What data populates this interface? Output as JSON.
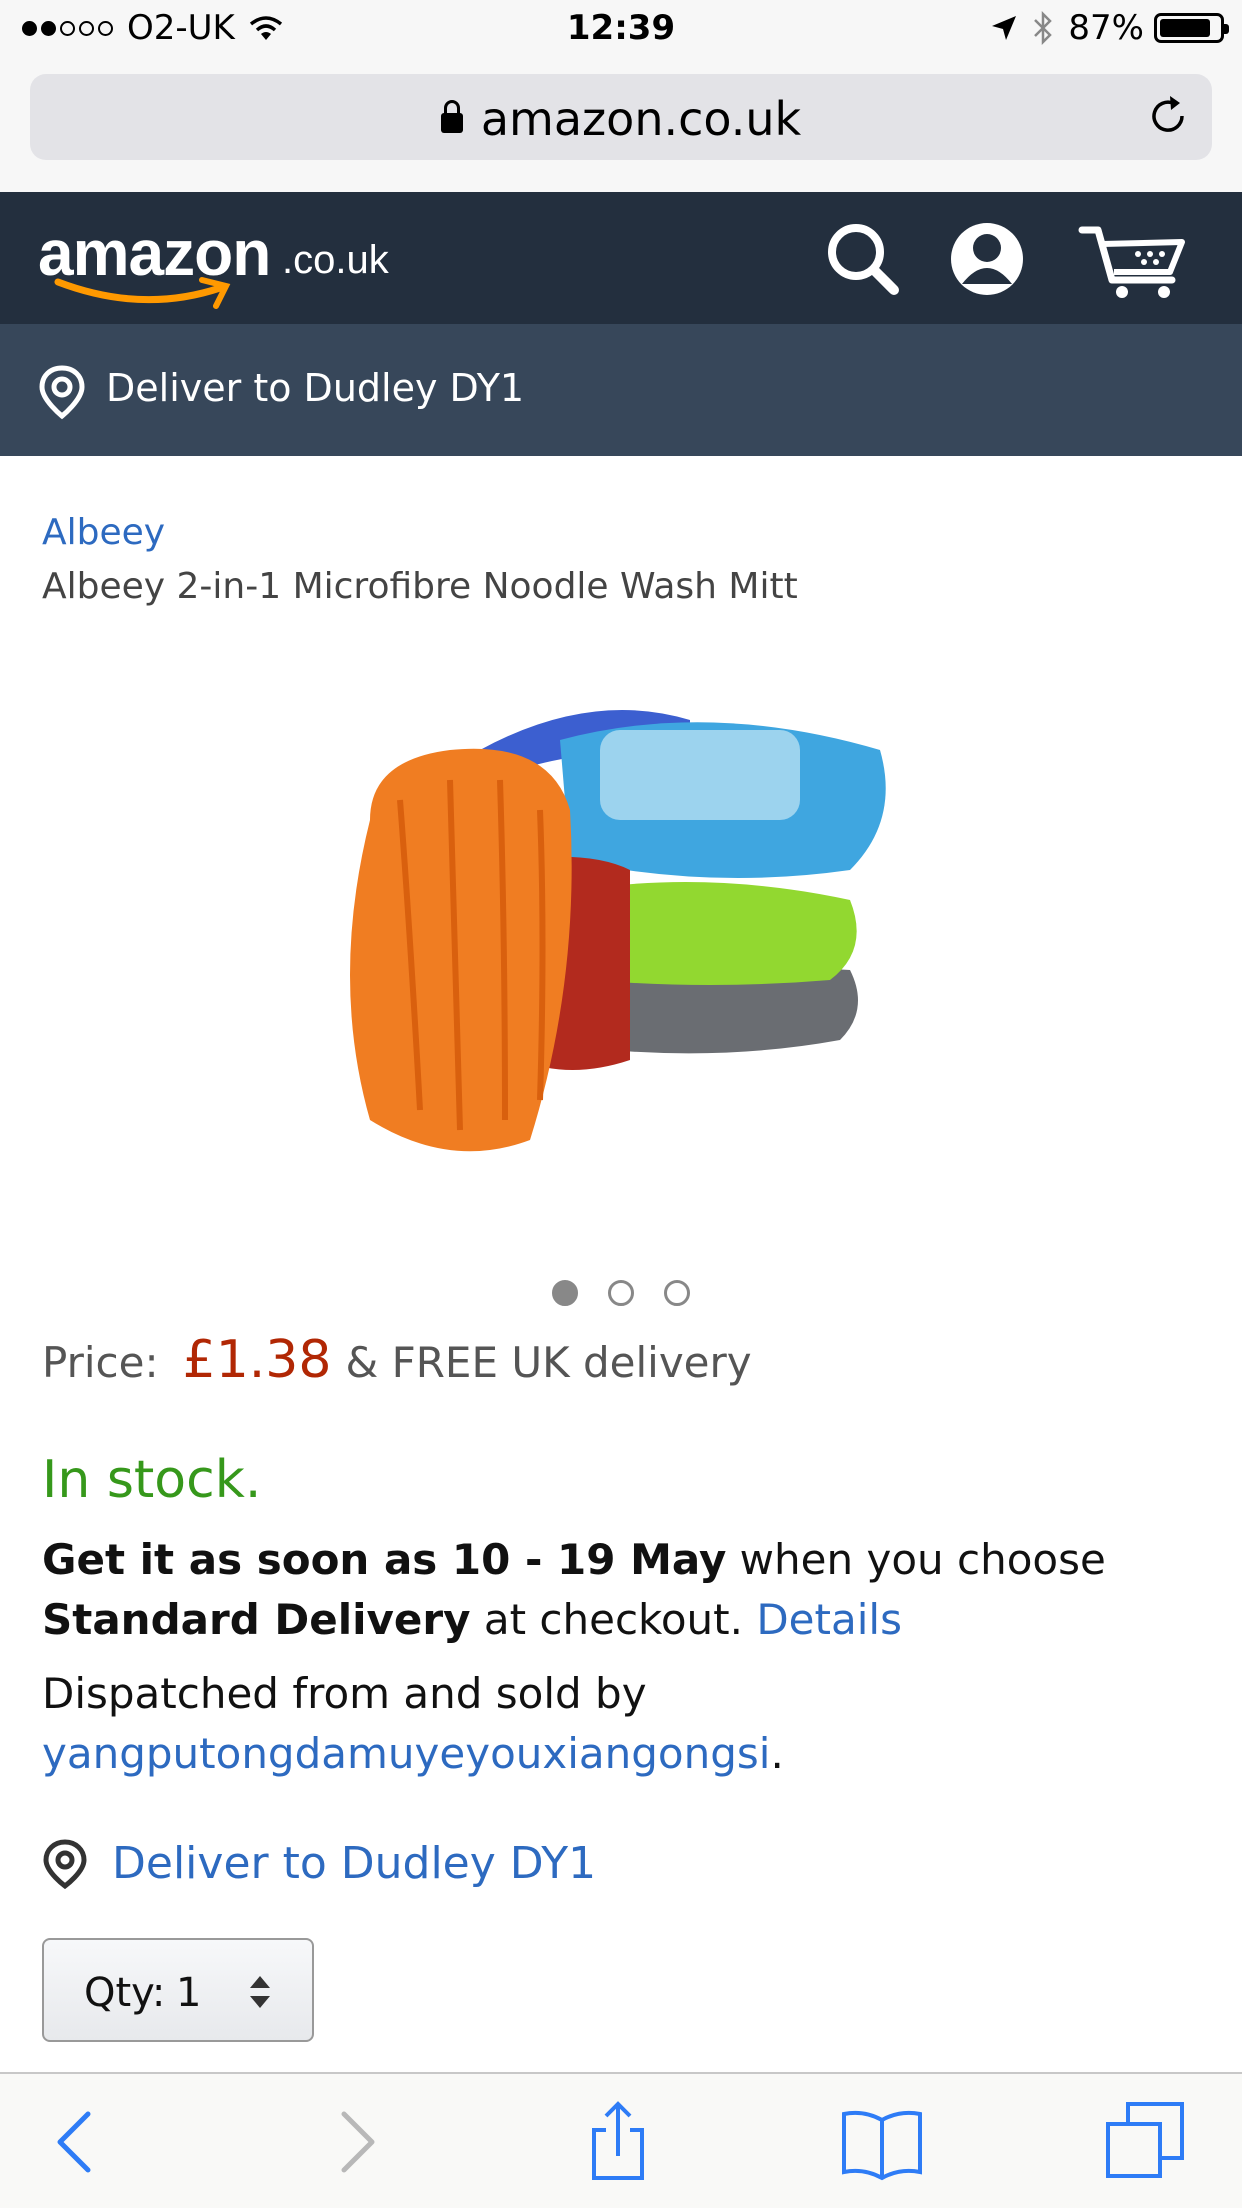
{
  "status_bar": {
    "carrier": "O2-UK",
    "time": "12:39",
    "battery": "87%",
    "battery_level": 0.87,
    "signal_bars": 2
  },
  "browser": {
    "url": "amazon.co.uk"
  },
  "header": {
    "logo_text": "amazon",
    "logo_suffix": ".co.uk",
    "icons": [
      "search-icon",
      "account-icon",
      "cart-icon"
    ]
  },
  "deliver_bar": {
    "text": "Deliver to Dudley DY1"
  },
  "product": {
    "brand": "Albeey",
    "title": "Albeey 2-in-1 Microfibre Noodle Wash Mitt",
    "image_count": 3,
    "active_image": 1,
    "price_label": "Price:",
    "price": "£1.38",
    "delivery_note": "& FREE UK delivery",
    "stock": "In stock.",
    "delivery": {
      "part1": "Get it as soon as 10 - 19 May",
      "part2": " when you choose ",
      "part3": "Standard Delivery",
      "part4": " at checkout. ",
      "details_link": "Details"
    },
    "dispatch": {
      "text": "Dispatched from and sold by",
      "seller": "yangputongdamuyeyouxiangongsi",
      "period": "."
    },
    "deliver_link": "Deliver to Dudley DY1",
    "qty_label": "Qty:",
    "qty_value": "1"
  },
  "colors": {
    "header_bg": "#232f3e",
    "deliver_bg": "#37475a",
    "link": "#2d6ac0",
    "price": "#b12704",
    "stock": "#36981b",
    "safari_blue": "#2e7cf6"
  },
  "toolbar": {
    "icons": [
      "back-icon",
      "forward-icon",
      "share-icon",
      "bookmarks-icon",
      "tabs-icon"
    ]
  }
}
